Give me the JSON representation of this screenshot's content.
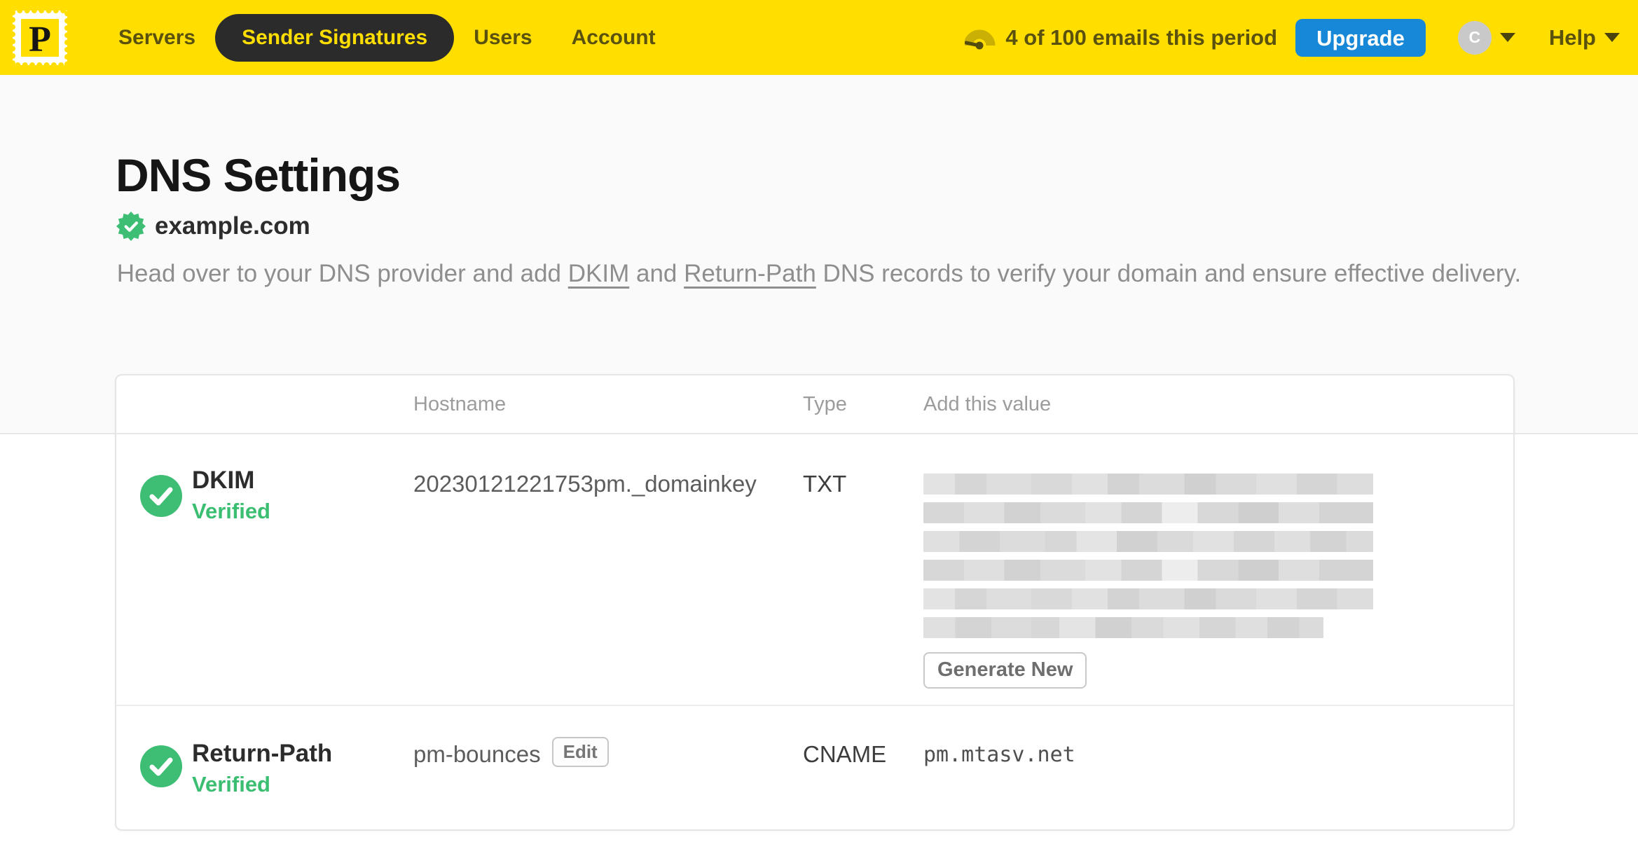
{
  "nav": {
    "brand_letter": "P",
    "items": [
      {
        "label": "Servers",
        "active": false
      },
      {
        "label": "Sender Signatures",
        "active": true
      },
      {
        "label": "Users",
        "active": false
      },
      {
        "label": "Account",
        "active": false
      }
    ],
    "usage_text": "4 of 100 emails this period",
    "upgrade_label": "Upgrade",
    "avatar_initial": "C",
    "help_label": "Help"
  },
  "page": {
    "title": "DNS Settings",
    "domain": "example.com",
    "intro": {
      "lead": "Head over to your DNS provider and add ",
      "link_dkim": "DKIM",
      "middle": " and ",
      "link_return_path": "Return-Path",
      "tail": " DNS records to verify your domain and ensure effective delivery."
    }
  },
  "table": {
    "columns": {
      "hostname": "Hostname",
      "type": "Type",
      "value": "Add this value"
    },
    "rows": [
      {
        "name": "DKIM",
        "status": "Verified",
        "hostname": "20230121221753pm._domainkey",
        "type": "TXT",
        "value_redacted": true,
        "action_label": "Generate New"
      },
      {
        "name": "Return-Path",
        "status": "Verified",
        "hostname": "pm-bounces",
        "edit_label": "Edit",
        "type": "CNAME",
        "value": "pm.mtasv.net"
      }
    ]
  },
  "colors": {
    "brand_yellow": "#ffde00",
    "nav_text": "#5a510c",
    "active_pill": "#2b2b2b",
    "upgrade_blue": "#1787d8",
    "success_green": "#3dbe74",
    "page_band": "#fafafa"
  }
}
